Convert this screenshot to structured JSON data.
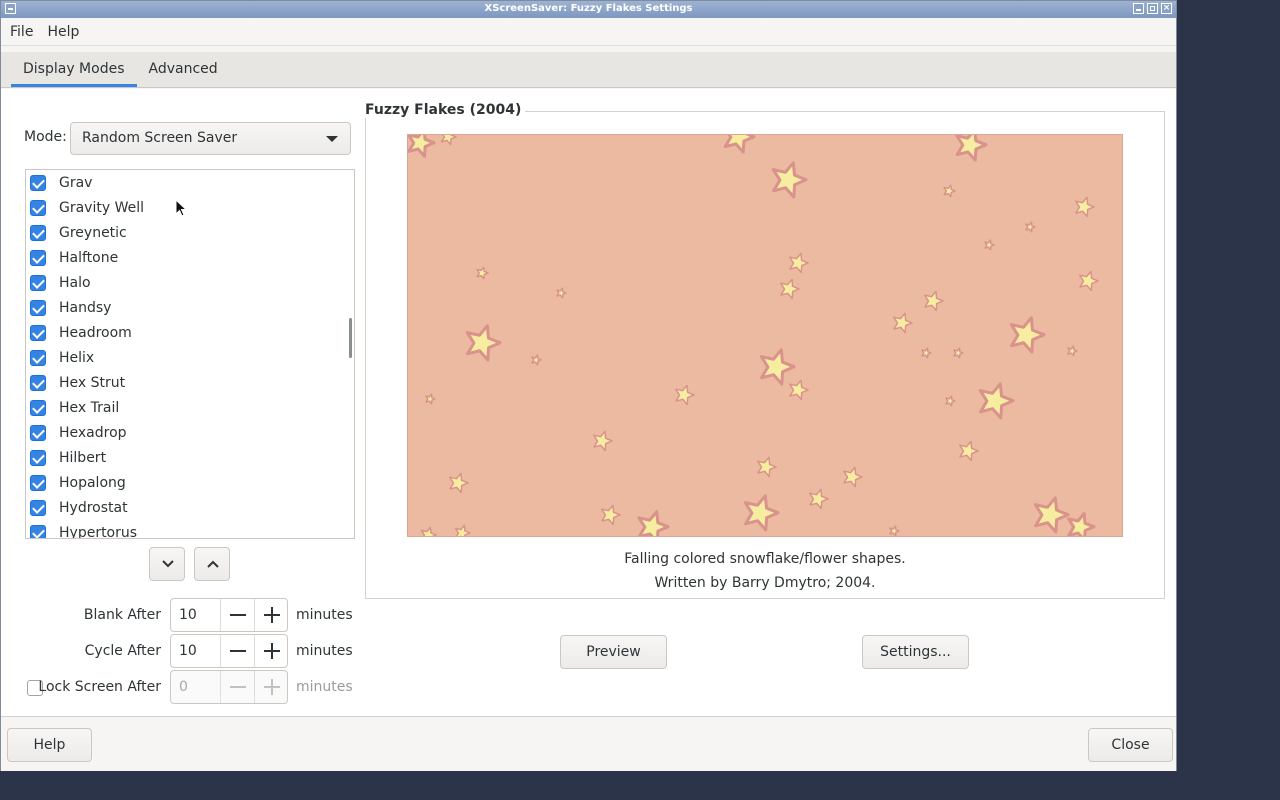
{
  "window": {
    "title": "XScreenSaver: Fuzzy Flakes Settings"
  },
  "menu": {
    "file": "File",
    "help": "Help"
  },
  "tabs": [
    {
      "label": "Display Modes"
    },
    {
      "label": "Advanced"
    }
  ],
  "mode": {
    "label": "Mode:",
    "selected": "Random Screen Saver"
  },
  "savers": [
    {
      "label": "Grav",
      "checked": true
    },
    {
      "label": "Gravity Well",
      "checked": true
    },
    {
      "label": "Greynetic",
      "checked": true
    },
    {
      "label": "Halftone",
      "checked": true
    },
    {
      "label": "Halo",
      "checked": true
    },
    {
      "label": "Handsy",
      "checked": true
    },
    {
      "label": "Headroom",
      "checked": true
    },
    {
      "label": "Helix",
      "checked": true
    },
    {
      "label": "Hex Strut",
      "checked": true
    },
    {
      "label": "Hex Trail",
      "checked": true
    },
    {
      "label": "Hexadrop",
      "checked": true
    },
    {
      "label": "Hilbert",
      "checked": true
    },
    {
      "label": "Hopalong",
      "checked": true
    },
    {
      "label": "Hydrostat",
      "checked": true
    },
    {
      "label": "Hypertorus",
      "checked": true
    }
  ],
  "timing": {
    "blank_label": "Blank After",
    "blank_value": "10",
    "cycle_label": "Cycle After",
    "cycle_value": "10",
    "lock_label": "Lock Screen After",
    "lock_value": "0",
    "lock_checked": false,
    "unit": "minutes"
  },
  "preview": {
    "title": "Fuzzy Flakes (2004)",
    "description": "Falling colored snowflake/flower shapes.",
    "author": "Written by Barry Dmytro; 2004.",
    "bg_color": "#ecb9a1",
    "flake_color": "#f7eda0",
    "flake_outline": "#d9928c"
  },
  "buttons": {
    "preview": "Preview",
    "settings": "Settings...",
    "help": "Help",
    "close": "Close"
  }
}
